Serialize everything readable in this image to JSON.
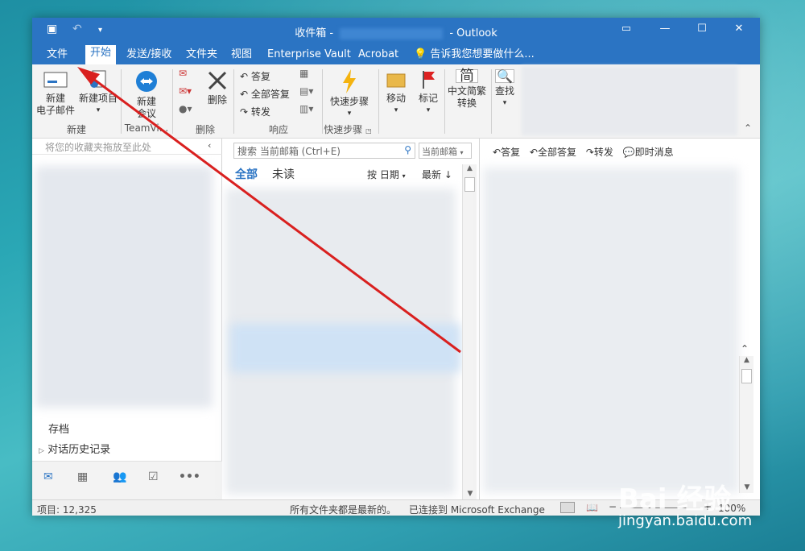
{
  "window": {
    "title": "收件箱 -",
    "app": "- Outlook"
  },
  "tabs": [
    "文件",
    "开始",
    "发送/接收",
    "文件夹",
    "视图",
    "Enterprise Vault",
    "Acrobat"
  ],
  "tell_me": "告诉我您想要做什么...",
  "ribbon": {
    "new_email": "新建\n电子邮件",
    "new_items": "新建项目",
    "new_meeting": "新建\n会议",
    "group_new": "新建",
    "group_teamviewer": "TeamVi...",
    "delete": "删除",
    "group_delete": "删除",
    "reply": "答复",
    "reply_all": "全部答复",
    "forward": "转发",
    "group_respond": "响应",
    "quick_steps": "快速步骤",
    "group_quick_steps": "快速步骤",
    "move": "移动",
    "tag": "标记",
    "chinese_convert": "中文简繁\n转换",
    "find": "查找",
    "convert_glyph": "简",
    "find_glyph": "🔍"
  },
  "left": {
    "favorites_hint": "将您的收藏夹拖放至此处",
    "archive": "存档",
    "history": "对话历史记录"
  },
  "middle": {
    "search_placeholder": "搜索 当前邮箱 (Ctrl+E)",
    "scope": "当前邮箱",
    "all": "全部",
    "unread": "未读",
    "sort": "按 日期",
    "order": "最新"
  },
  "reading": {
    "reply": "答复",
    "reply_all": "全部答复",
    "forward": "转发",
    "im": "即时消息"
  },
  "status": {
    "items": "项目: 12,325",
    "uptodate": "所有文件夹都是最新的。",
    "connected": "已连接到 Microsoft Exchange",
    "zoom": "100%"
  },
  "watermark": {
    "brand": "Bai 经验",
    "url": "jingyan.baidu.com"
  },
  "colors": {
    "accent": "#2b74c3",
    "arrow": "#d9201f"
  }
}
